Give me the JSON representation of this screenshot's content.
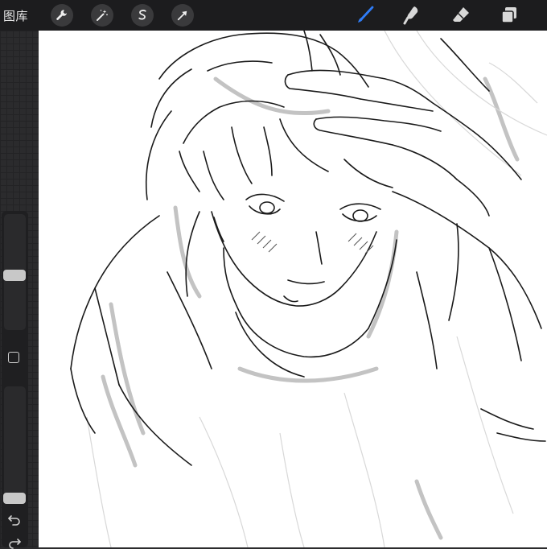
{
  "toolbar": {
    "gallery_label": "图库",
    "left_tools": [
      "wrench-icon",
      "magic-wand-icon",
      "selection-icon",
      "transform-arrow-icon"
    ],
    "right_tools": [
      "brush-icon",
      "smudge-icon",
      "eraser-icon",
      "layers-icon"
    ],
    "active_tool": "brush-icon",
    "accent_color": "#2f7cf6"
  },
  "sidebar": {
    "brush_size_level": 0.47,
    "opacity_level": 0.0,
    "modify_button_icon": "square-icon",
    "undo_icon": "undo-arrow-icon",
    "redo_icon": "redo-arrow-icon"
  },
  "canvas": {
    "background_color": "#ffffff",
    "content": "sketch-drawing"
  }
}
